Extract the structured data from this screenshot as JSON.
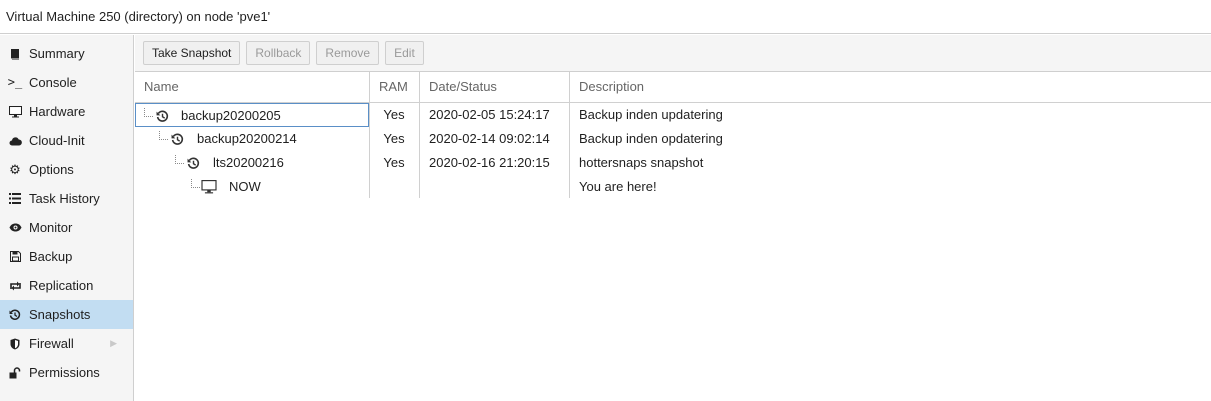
{
  "window": {
    "title": "Virtual Machine 250 (directory) on node 'pve1'"
  },
  "sidebar": {
    "items": [
      {
        "label": "Summary",
        "icon": "book-icon"
      },
      {
        "label": "Console",
        "icon": "terminal-icon"
      },
      {
        "label": "Hardware",
        "icon": "desktop-icon"
      },
      {
        "label": "Cloud-Init",
        "icon": "cloud-icon"
      },
      {
        "label": "Options",
        "icon": "gear-icon"
      },
      {
        "label": "Task History",
        "icon": "list-icon"
      },
      {
        "label": "Monitor",
        "icon": "eye-icon"
      },
      {
        "label": "Backup",
        "icon": "floppy-icon"
      },
      {
        "label": "Replication",
        "icon": "retweet-icon"
      },
      {
        "label": "Snapshots",
        "icon": "history-icon",
        "selected": true
      },
      {
        "label": "Firewall",
        "icon": "shield-icon",
        "has_submenu": true
      },
      {
        "label": "Permissions",
        "icon": "unlock-icon"
      }
    ]
  },
  "toolbar": {
    "take_snapshot": "Take Snapshot",
    "rollback": "Rollback",
    "remove": "Remove",
    "edit": "Edit"
  },
  "grid": {
    "columns": [
      "Name",
      "RAM",
      "Date/Status",
      "Description"
    ],
    "rows": [
      {
        "name": "backup20200205",
        "ram": "Yes",
        "date": "2020-02-05 15:24:17",
        "description": "Backup inden updatering",
        "icon": "history-icon"
      },
      {
        "name": "backup20200214",
        "ram": "Yes",
        "date": "2020-02-14 09:02:14",
        "description": "Backup inden opdatering",
        "icon": "history-icon"
      },
      {
        "name": "lts20200216",
        "ram": "Yes",
        "date": "2020-02-16 21:20:15",
        "description": "hottersnaps snapshot",
        "icon": "history-icon"
      },
      {
        "name": "NOW",
        "ram": "",
        "date": "",
        "description": "You are here!",
        "icon": "desktop-icon"
      }
    ]
  },
  "colors": {
    "selected_bg": "#c2ddf2",
    "focus_border": "#5a8fc7",
    "panel_bg": "#f5f5f5"
  }
}
